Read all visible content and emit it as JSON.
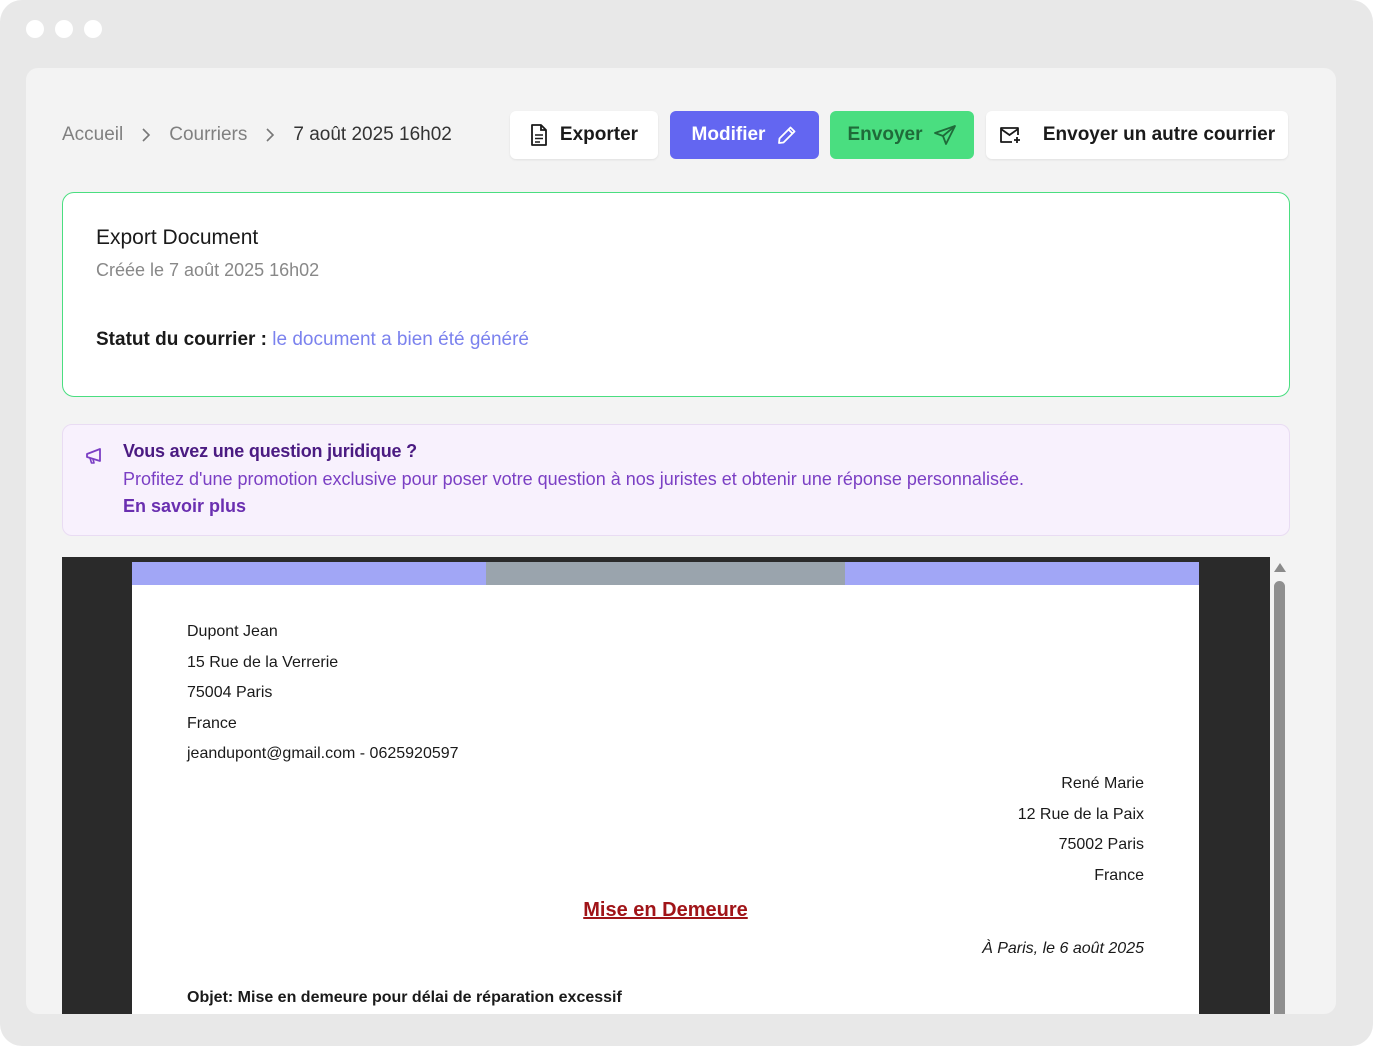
{
  "breadcrumb": {
    "home": "Accueil",
    "section": "Courriers",
    "current": "7 août 2025 16h02"
  },
  "toolbar": {
    "export_label": "Exporter",
    "modify_label": "Modifier",
    "send_label": "Envoyer",
    "send_other_label": "Envoyer un autre courrier"
  },
  "status_card": {
    "title": "Export Document",
    "created": "Créée le 7 août 2025 16h02",
    "status_label": "Statut du courrier :",
    "status_value": "le document a bien été généré"
  },
  "promo": {
    "icon": "megaphone-icon",
    "title": "Vous avez une question juridique ?",
    "text": "Profitez d'une promotion exclusive pour poser votre question à nos juristes et obtenir une réponse personnalisée.",
    "link": "En savoir plus"
  },
  "document": {
    "sender": {
      "name": "Dupont Jean",
      "street": "15 Rue de la Verrerie",
      "city": "75004 Paris",
      "country": "France",
      "contact": "jeandupont@gmail.com - 0625920597"
    },
    "recipient": {
      "name": "René Marie",
      "street": "12 Rue de la Paix",
      "city": "75002 Paris",
      "country": "France"
    },
    "title": "Mise en Demeure",
    "date": "À Paris, le 6 août 2025",
    "subject": "Objet: Mise en demeure pour délai de réparation excessif"
  },
  "colors": {
    "primary": "#6366f1",
    "success": "#4ade80",
    "promo_bg": "#f8f1fd",
    "doc_title": "#a01418"
  }
}
